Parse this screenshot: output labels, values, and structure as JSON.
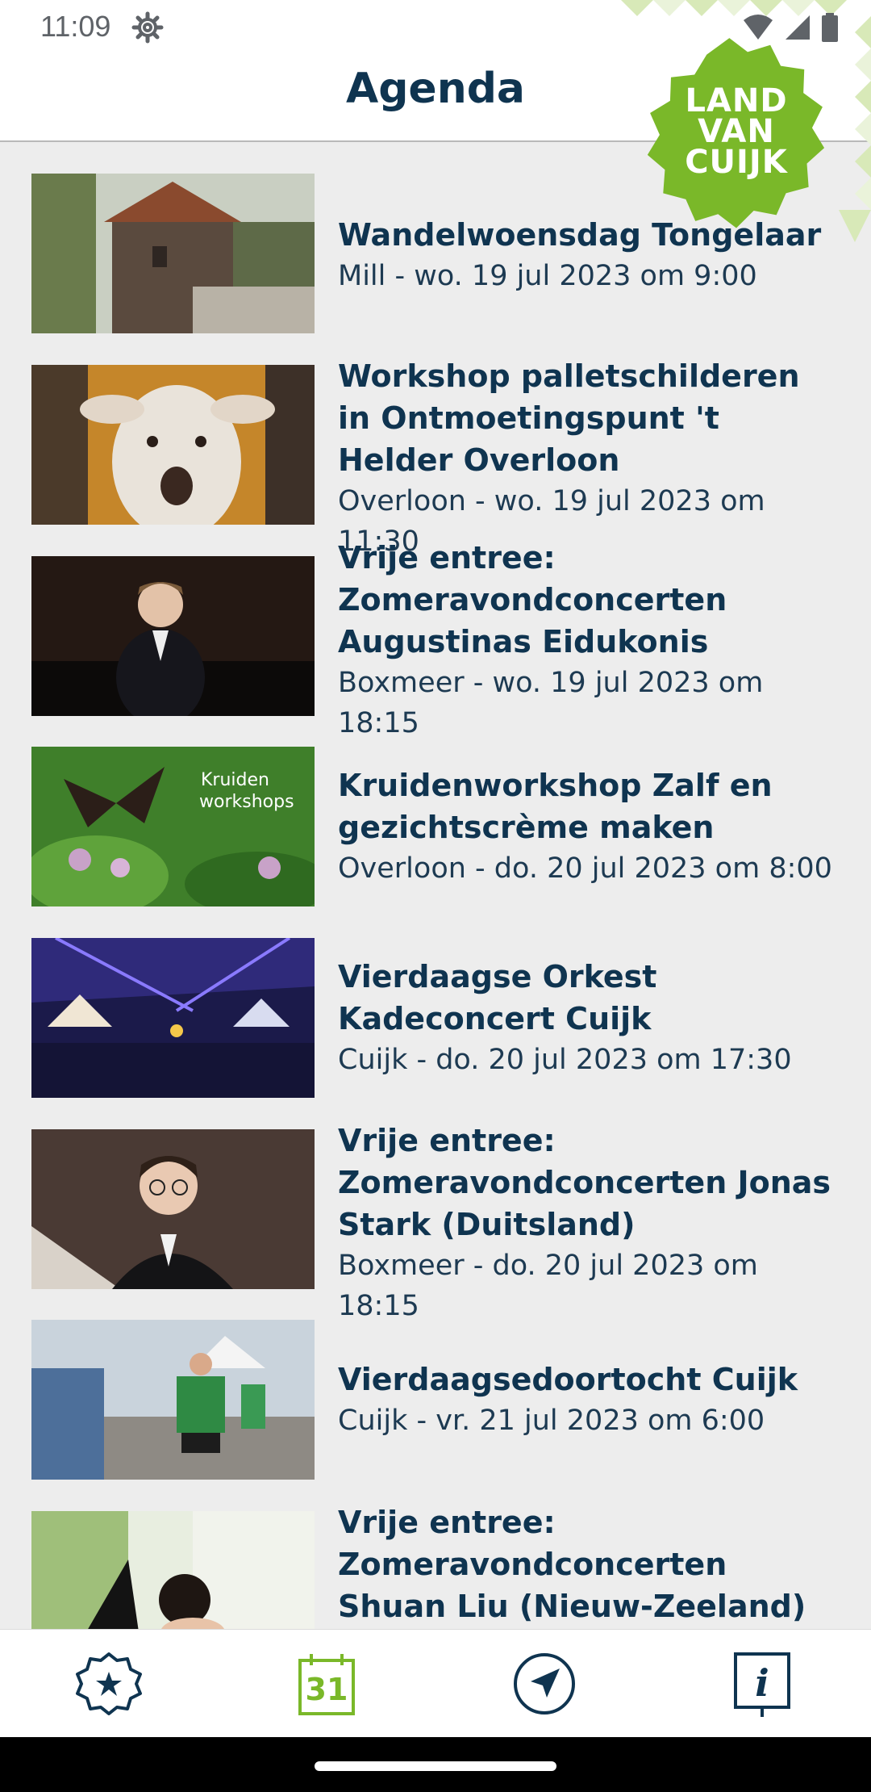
{
  "status_bar": {
    "time": "11:09"
  },
  "header": {
    "title": "Agenda"
  },
  "badge": {
    "line1": "LAND",
    "line2": "VAN",
    "line3": "CUIJK"
  },
  "events": [
    {
      "title": "Wandelwoensdag Tongelaar",
      "meta": "Mill - wo. 19 jul 2023 om 9:00",
      "thumb": "tower"
    },
    {
      "title": "Workshop palletschilderen in Ontmoetingspunt 't Helder Overloon",
      "meta": "Overloon - wo. 19 jul 2023 om 11:30",
      "thumb": "lamb"
    },
    {
      "title": "Vrije entree: Zomeravondconcerten Augustinas Eidukonis",
      "meta": "Boxmeer - wo. 19 jul 2023 om 18:15",
      "thumb": "pianist"
    },
    {
      "title": "Kruidenworkshop Zalf en gezichtscrème maken",
      "meta": "Overloon - do. 20 jul 2023 om 8:00",
      "thumb": "butterfly",
      "thumb_caption": "Kruiden workshops"
    },
    {
      "title": "Vierdaagse Orkest Kadeconcert Cuijk",
      "meta": "Cuijk - do. 20 jul 2023 om 17:30",
      "thumb": "concert"
    },
    {
      "title": "Vrije entree: Zomeravondconcerten Jonas Stark (Duitsland)",
      "meta": "Boxmeer - do. 20 jul 2023 om 18:15",
      "thumb": "portrait"
    },
    {
      "title": "Vierdaagsedoortocht Cuijk",
      "meta": "Cuijk - vr. 21 jul 2023 om 6:00",
      "thumb": "walkers"
    },
    {
      "title": "Vrije entree: Zomeravondconcerten Shuan Liu (Nieuw-Zeeland)",
      "meta": "",
      "thumb": "piano-girl"
    }
  ],
  "bottom_nav": {
    "calendar_day": "31",
    "items": [
      "favorites-icon",
      "calendar-icon",
      "navigation-icon",
      "info-icon"
    ],
    "active_color": "#7ab829",
    "color": "#0f3450"
  },
  "colors": {
    "brand_green": "#7ab829",
    "text_dark": "#0f3450",
    "pattern_light": "#d8e9b8"
  }
}
